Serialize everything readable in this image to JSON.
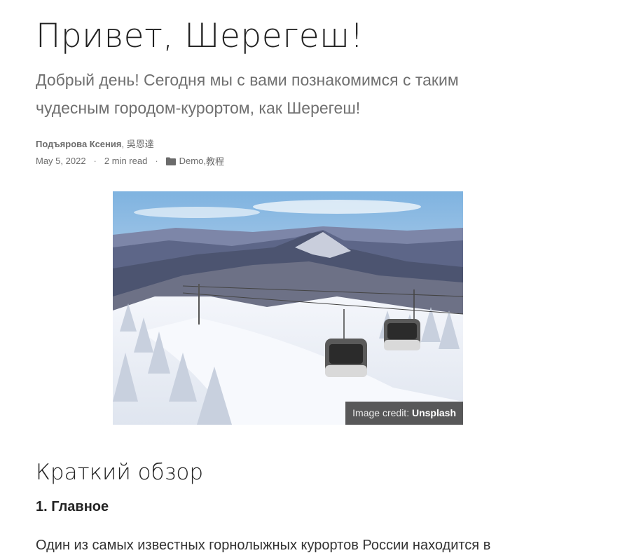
{
  "article": {
    "title": "Привет, Шерегеш!",
    "subtitle": "Добрый день! Сегодня мы с вами познакомимся с таким чудесным городом-курортом, как Шерегеш!",
    "authors": [
      "Подъярова Ксения",
      "吳恩達"
    ],
    "author_separator": ", ",
    "date": "May 5, 2022",
    "separator": "·",
    "read_time": "2 min read",
    "categories": [
      "Demo",
      "教程"
    ],
    "category_separator": ", "
  },
  "hero": {
    "credit_prefix": "Image credit: ",
    "credit_source": "Unsplash",
    "icon": "folder-icon"
  },
  "content": {
    "section_title": "Краткий обзор",
    "sub_heading": "1. Главное",
    "paragraph": "Один из самых известных горнолыжных курортов России находится в"
  }
}
